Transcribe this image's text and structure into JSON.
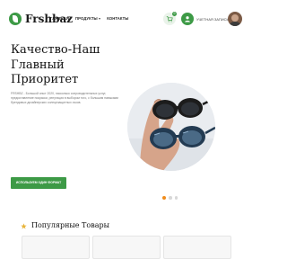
{
  "header": {
    "logo_text": "Frshbaz",
    "nav": [
      "ГЛАВНАЯ",
      "ПРОДУКТЫ",
      "КОНТАКТЫ"
    ],
    "cart_count": "0",
    "account_label": "УЧЕТНАЯ ЗАПИСЬ"
  },
  "hero": {
    "title": "Качество-Наш Главный Приоритет",
    "description": "FRSHBZ - Большой опыт 2020, насколько сопроводительных услуг, предоставление покраски, репутация в выбором того, с большим навыками брендовых дизайнерских солнцезащитных очков.",
    "cta_label": "ИСПОЛЬЗУЕМ ОДИН ФОРМАТ",
    "slides": 3,
    "active_slide": 1
  },
  "popular": {
    "title": "Популярные Товары"
  },
  "colors": {
    "accent": "#3d9a46",
    "dot_active": "#f08c1c"
  },
  "icons": [
    "leaf-logo-icon",
    "cart-icon",
    "user-icon",
    "star-icon",
    "chevron-down-icon"
  ]
}
